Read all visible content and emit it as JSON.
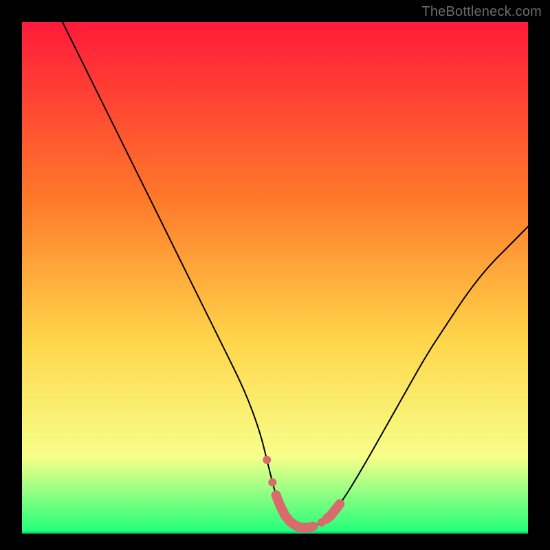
{
  "watermark": "TheBottleneck.com",
  "colors": {
    "background": "#000000",
    "gradient_top": "#ff1a3a",
    "gradient_mid_upper": "#ff7a2a",
    "gradient_mid": "#ffd54a",
    "gradient_lower": "#f7ff8a",
    "gradient_base": "#1eff7a",
    "curve": "#000000",
    "markers": "#d86b6b",
    "baseline": "#00e27a",
    "watermark_text": "#6b6b6b"
  },
  "chart_data": {
    "type": "line",
    "title": "",
    "xlabel": "",
    "ylabel": "",
    "xlim": [
      0,
      100
    ],
    "ylim": [
      0,
      100
    ],
    "grid": false,
    "legend": false,
    "series": [
      {
        "name": "bottleneck-curve",
        "x": [
          8,
          12,
          16,
          20,
          24,
          28,
          32,
          36,
          40,
          44,
          47,
          48.5,
          50,
          51,
          52,
          53,
          54,
          55,
          56,
          57,
          58,
          59.5,
          61,
          63,
          65,
          68,
          72,
          76,
          80,
          84,
          88,
          92,
          96,
          100
        ],
        "y": [
          100,
          92,
          84,
          76,
          68,
          60,
          52,
          44,
          36,
          28,
          20,
          14,
          8,
          5.5,
          3.5,
          2.3,
          1.6,
          1.2,
          1.1,
          1.2,
          1.6,
          2.3,
          3.5,
          6,
          9,
          14,
          21,
          28,
          35,
          41,
          47,
          52,
          56,
          60
        ]
      }
    ],
    "highlight_segments": [
      {
        "x_start": 48.0,
        "x_end": 48.8
      },
      {
        "x_start": 49.2,
        "x_end": 49.8
      },
      {
        "x_start": 50.2,
        "x_end": 57.5
      },
      {
        "x_start": 59.0,
        "x_end": 59.4
      },
      {
        "x_start": 60.2,
        "x_end": 62.8
      }
    ]
  }
}
